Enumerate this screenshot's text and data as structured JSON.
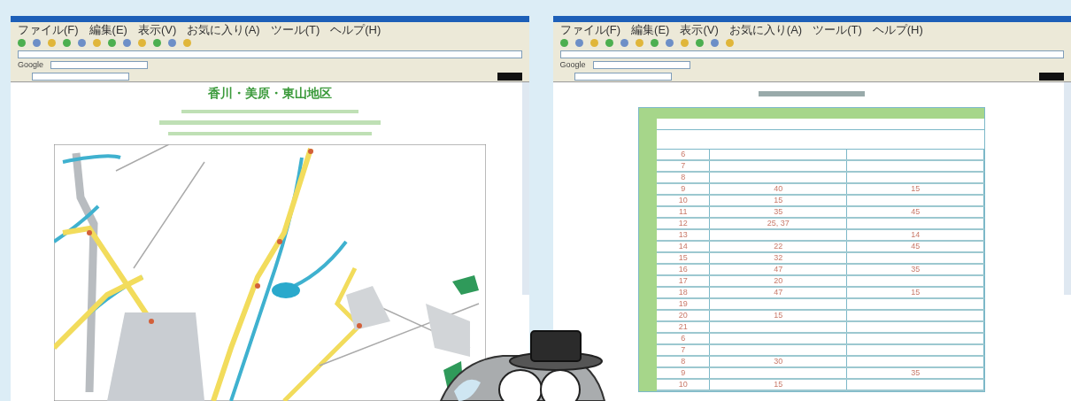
{
  "windows": [
    {
      "kind": "map",
      "menu": [
        "ファイル(F)",
        "編集(E)",
        "表示(V)",
        "お気に入り(A)",
        "ツール(T)",
        "ヘルプ(H)"
      ],
      "toolbar_label": "Google",
      "page": {
        "heading": "香川・美原・東山地区"
      }
    },
    {
      "kind": "table",
      "menu": [
        "ファイル(F)",
        "編集(E)",
        "表示(V)",
        "お気に入り(A)",
        "ツール(T)",
        "ヘルプ(H)"
      ],
      "toolbar_label": "Google",
      "page": {
        "table": {
          "rows": [
            {
              "hour": "6",
              "col_2": "",
              "col_3": ""
            },
            {
              "hour": "7",
              "col_2": "",
              "col_3": ""
            },
            {
              "hour": "8",
              "col_2": "",
              "col_3": ""
            },
            {
              "hour": "9",
              "col_2": "40",
              "col_3": "15"
            },
            {
              "hour": "10",
              "col_2": "15",
              "col_3": ""
            },
            {
              "hour": "11",
              "col_2": "35",
              "col_3": "45"
            },
            {
              "hour": "12",
              "col_2": "25, 37",
              "col_3": ""
            },
            {
              "hour": "13",
              "col_2": "",
              "col_3": "14"
            },
            {
              "hour": "14",
              "col_2": "22",
              "col_3": "45"
            },
            {
              "hour": "15",
              "col_2": "32",
              "col_3": ""
            },
            {
              "hour": "16",
              "col_2": "47",
              "col_3": "35"
            },
            {
              "hour": "17",
              "col_2": "20",
              "col_3": ""
            },
            {
              "hour": "18",
              "col_2": "47",
              "col_3": "15"
            },
            {
              "hour": "19",
              "col_2": "",
              "col_3": ""
            },
            {
              "hour": "20",
              "col_2": "15",
              "col_3": ""
            },
            {
              "hour": "21",
              "col_2": "",
              "col_3": ""
            },
            {
              "hour": "6",
              "col_2": "",
              "col_3": ""
            },
            {
              "hour": "7",
              "col_2": "",
              "col_3": ""
            },
            {
              "hour": "8",
              "col_2": "30",
              "col_3": ""
            },
            {
              "hour": "9",
              "col_2": "",
              "col_3": "35"
            },
            {
              "hour": "10",
              "col_2": "15",
              "col_3": ""
            }
          ]
        }
      }
    }
  ]
}
